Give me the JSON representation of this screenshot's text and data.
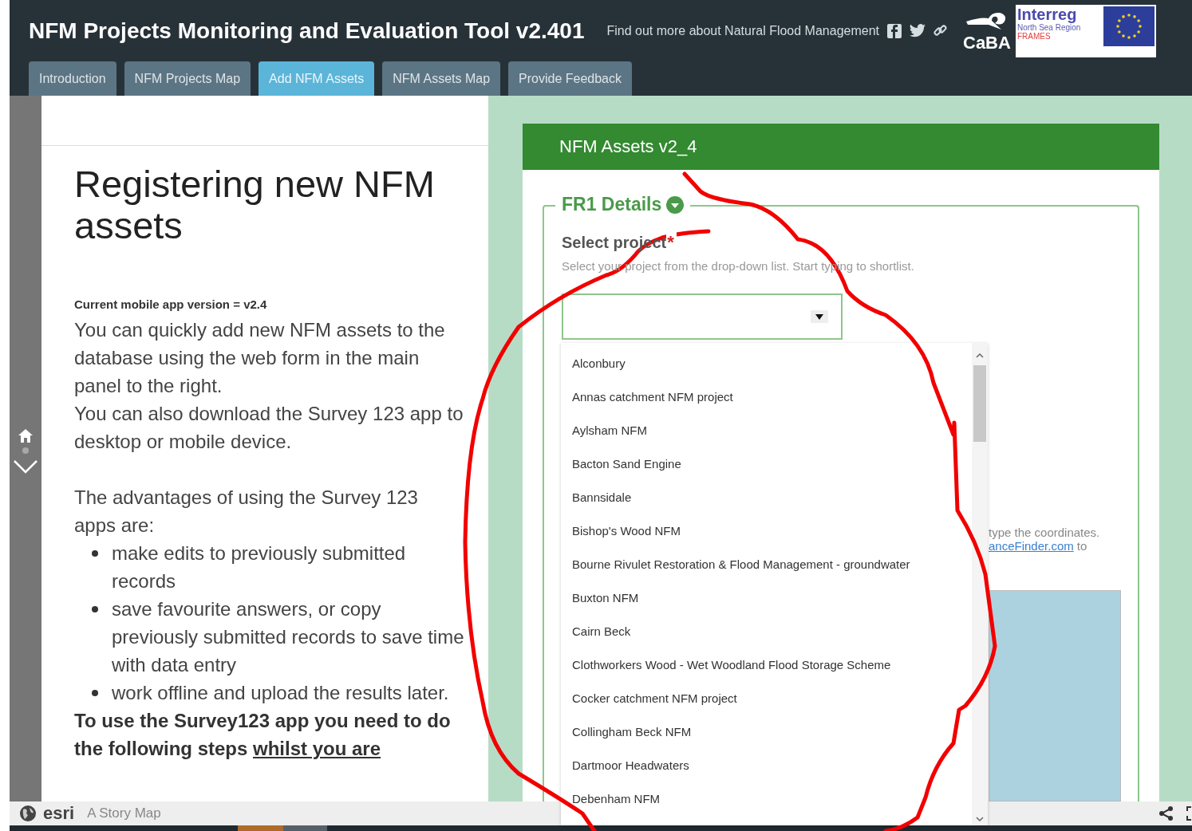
{
  "header": {
    "title": "NFM Projects Monitoring and Evaluation Tool v2.401",
    "about_link": "Find out more about Natural Flood Management",
    "logos": {
      "caba": "CaBA",
      "interreg": "Interreg",
      "region": "North Sea Region",
      "project": "FRAMES"
    }
  },
  "tabs": [
    {
      "label": "Introduction",
      "selected": false
    },
    {
      "label": "NFM Projects Map",
      "selected": false
    },
    {
      "label": "Add NFM Assets",
      "selected": true
    },
    {
      "label": "NFM Assets Map",
      "selected": false
    },
    {
      "label": "Provide Feedback",
      "selected": false
    }
  ],
  "story": {
    "heading": "Registering new NFM assets",
    "version_note": "Current mobile app version = v2.4",
    "paragraphs": [
      "You can quickly add new NFM assets to the database using the web form in the main panel to the right.",
      "You can also download the Survey 123 app to desktop or mobile device."
    ],
    "advantages_intro": "The advantages of using the Survey 123 apps are:",
    "advantages": [
      "make edits to previously submitted records",
      "save favourite answers, or copy previously submitted records to save time with data entry",
      "work offline and upload the results later."
    ],
    "steps_intro": "To use the Survey123 app you need to do the following steps ",
    "steps_link": "whilst you are"
  },
  "form": {
    "title": "NFM Assets v2_4",
    "section": "FR1 Details",
    "question": {
      "label": "Select project",
      "required": "*",
      "hint": "Select your project from the drop-down list. Start typing to shortlist."
    },
    "options": [
      "Alconbury",
      "Annas catchment NFM project",
      "Aylsham NFM",
      "Bacton Sand Engine",
      "Bannsidale",
      "Bishop's Wood NFM",
      "Bourne Rivulet Restoration & Flood Management - groundwater",
      "Buxton NFM",
      "Cairn Beck",
      "Clothworkers Wood - Wet Woodland Flood Storage Scheme",
      "Cocker catchment NFM project",
      "Collingham Beck NFM",
      "Dartmoor Headwaters",
      "Debenham NFM"
    ],
    "coords_hint": "type the coordinates.",
    "coords_link": "anceFinder.com",
    "coords_tail": "to"
  },
  "footer": {
    "brand": "esri",
    "label": "A Story Map"
  }
}
